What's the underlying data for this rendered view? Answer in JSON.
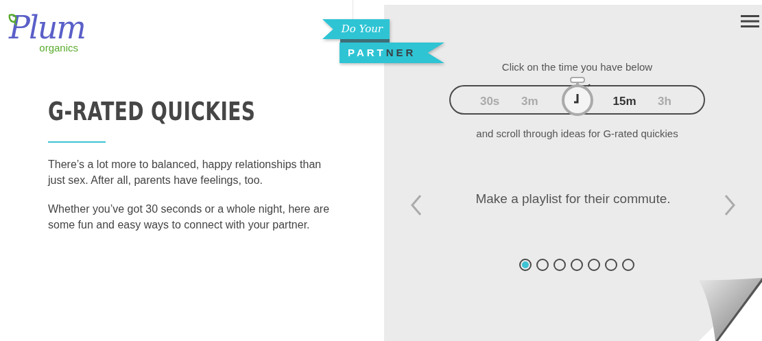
{
  "logo": {
    "name": "Plum",
    "tagline": "organics"
  },
  "banner": {
    "line_1": "Do Your",
    "line_2_parts": [
      {
        "text": "PART",
        "kind": "light"
      },
      {
        "text": "NER",
        "kind": "dark"
      }
    ]
  },
  "intro": {
    "title": "G-RATED QUICKIES",
    "paragraphs": [
      "There’s a lot more to balanced, happy relationships than just sex. After all, parents have feelings, too.",
      "Whether you’ve got 30 seconds or a whole night, here are some fun and easy ways to connect with your partner."
    ]
  },
  "picker": {
    "prompt": "Click on the time you have below",
    "options": [
      {
        "label": "30s",
        "selected": false
      },
      {
        "label": "3m",
        "selected": false
      },
      {
        "label": "15m",
        "selected": true
      },
      {
        "label": "3h",
        "selected": false
      }
    ],
    "caption": "and scroll through ideas for G-rated quickies"
  },
  "carousel": {
    "idea": "Make a playlist for their commute.",
    "dots": [
      {
        "selected": true
      },
      {
        "selected": false
      },
      {
        "selected": false
      },
      {
        "selected": false
      },
      {
        "selected": false
      },
      {
        "selected": false
      },
      {
        "selected": false
      }
    ]
  }
}
